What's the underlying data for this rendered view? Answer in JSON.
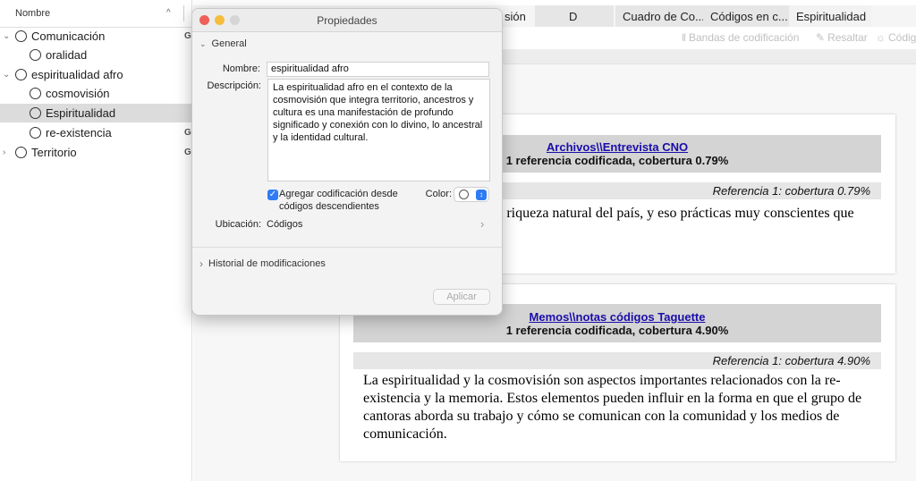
{
  "tree": {
    "header": "Nombre",
    "rows": [
      {
        "label": "Comunicación",
        "mark": "G"
      },
      {
        "label": "oralidad",
        "mark": ""
      },
      {
        "label": "espiritualidad afro",
        "mark": ""
      },
      {
        "label": "cosmovisión",
        "mark": ""
      },
      {
        "label": "Espiritualidad",
        "mark": ""
      },
      {
        "label": "re-existencia",
        "mark": "G"
      },
      {
        "label": "Territorio",
        "mark": "G"
      }
    ]
  },
  "tabs": [
    "sión",
    "D",
    "Cuadro de Co...",
    "Códigos en c...",
    "Espiritualidad"
  ],
  "toolbar": {
    "bands": "Bandas de codificación",
    "highlight": "Resaltar",
    "codes": "Códigos"
  },
  "cards": [
    {
      "link": "Archivos\\\\Entrevista CNO",
      "summary": "1 referencia codificada, cobertura 0.79%",
      "ref": "Referencia 1: cobertura 0.79%",
      "text": "or de la naturaleza, de la riqueza natural del país, y eso prácticas muy conscientes que hacen parte de nuestra"
    },
    {
      "link": "Memos\\\\notas códigos Taguette",
      "summary": "1 referencia codificada, cobertura 4.90%",
      "ref": "Referencia 1: cobertura 4.90%",
      "text": "La espiritualidad y la cosmovisión son aspectos importantes relacionados con la re-existencia y la memoria. Estos elementos pueden influir en la forma en que el grupo de cantoras aborda su trabajo y cómo se comunican con la comunidad y los medios de comunicación."
    }
  ],
  "properties": {
    "title": "Propiedades",
    "general": "General",
    "name_label": "Nombre:",
    "name_value": "espiritualidad afro",
    "desc_label": "Descripción:",
    "desc_value": "La espiritualidad afro en el contexto de la cosmovisión que integra territorio, ancestros y cultura es una manifestación de profundo significado y conexión con lo divino, lo ancestral y la identidad cultural.",
    "checkbox_label": "Agregar codificación desde códigos descendientes",
    "checkbox_checked": true,
    "color_label": "Color:",
    "location_label": "Ubicación:",
    "location_value": "Códigos",
    "history": "Historial de modificaciones",
    "apply": "Aplicar"
  },
  "colors": {
    "close": "#ee5f57",
    "minimize": "#f6bd3b",
    "zoom": "#d5d5d5",
    "link": "#1a0dab",
    "checkbox": "#2f7bf5"
  }
}
